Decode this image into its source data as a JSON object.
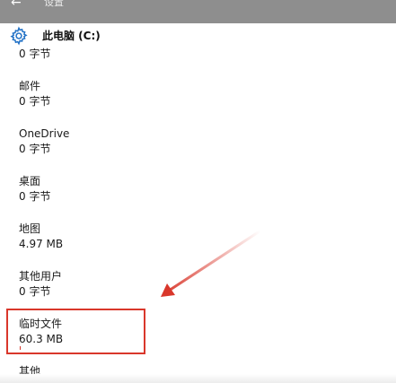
{
  "window": {
    "title": "设置",
    "back_icon": "back-arrow-icon"
  },
  "header": {
    "title": "此电脑 (C:)",
    "icon": "gear-icon"
  },
  "partial_top_size": "0 字节",
  "items": [
    {
      "name": "邮件",
      "size": "0 字节"
    },
    {
      "name": "OneDrive",
      "size": "0 字节"
    },
    {
      "name": "桌面",
      "size": "0 字节"
    },
    {
      "name": "地图",
      "size": "4.97 MB"
    },
    {
      "name": "其他用户",
      "size": "0 字节"
    },
    {
      "name": "临时文件",
      "size": "60.3 MB"
    },
    {
      "name": "其他",
      "size": ""
    }
  ],
  "colors": {
    "titlebar": "#8e8e8e",
    "annotation": "#d9372b",
    "accent": "#1e6fc5"
  }
}
